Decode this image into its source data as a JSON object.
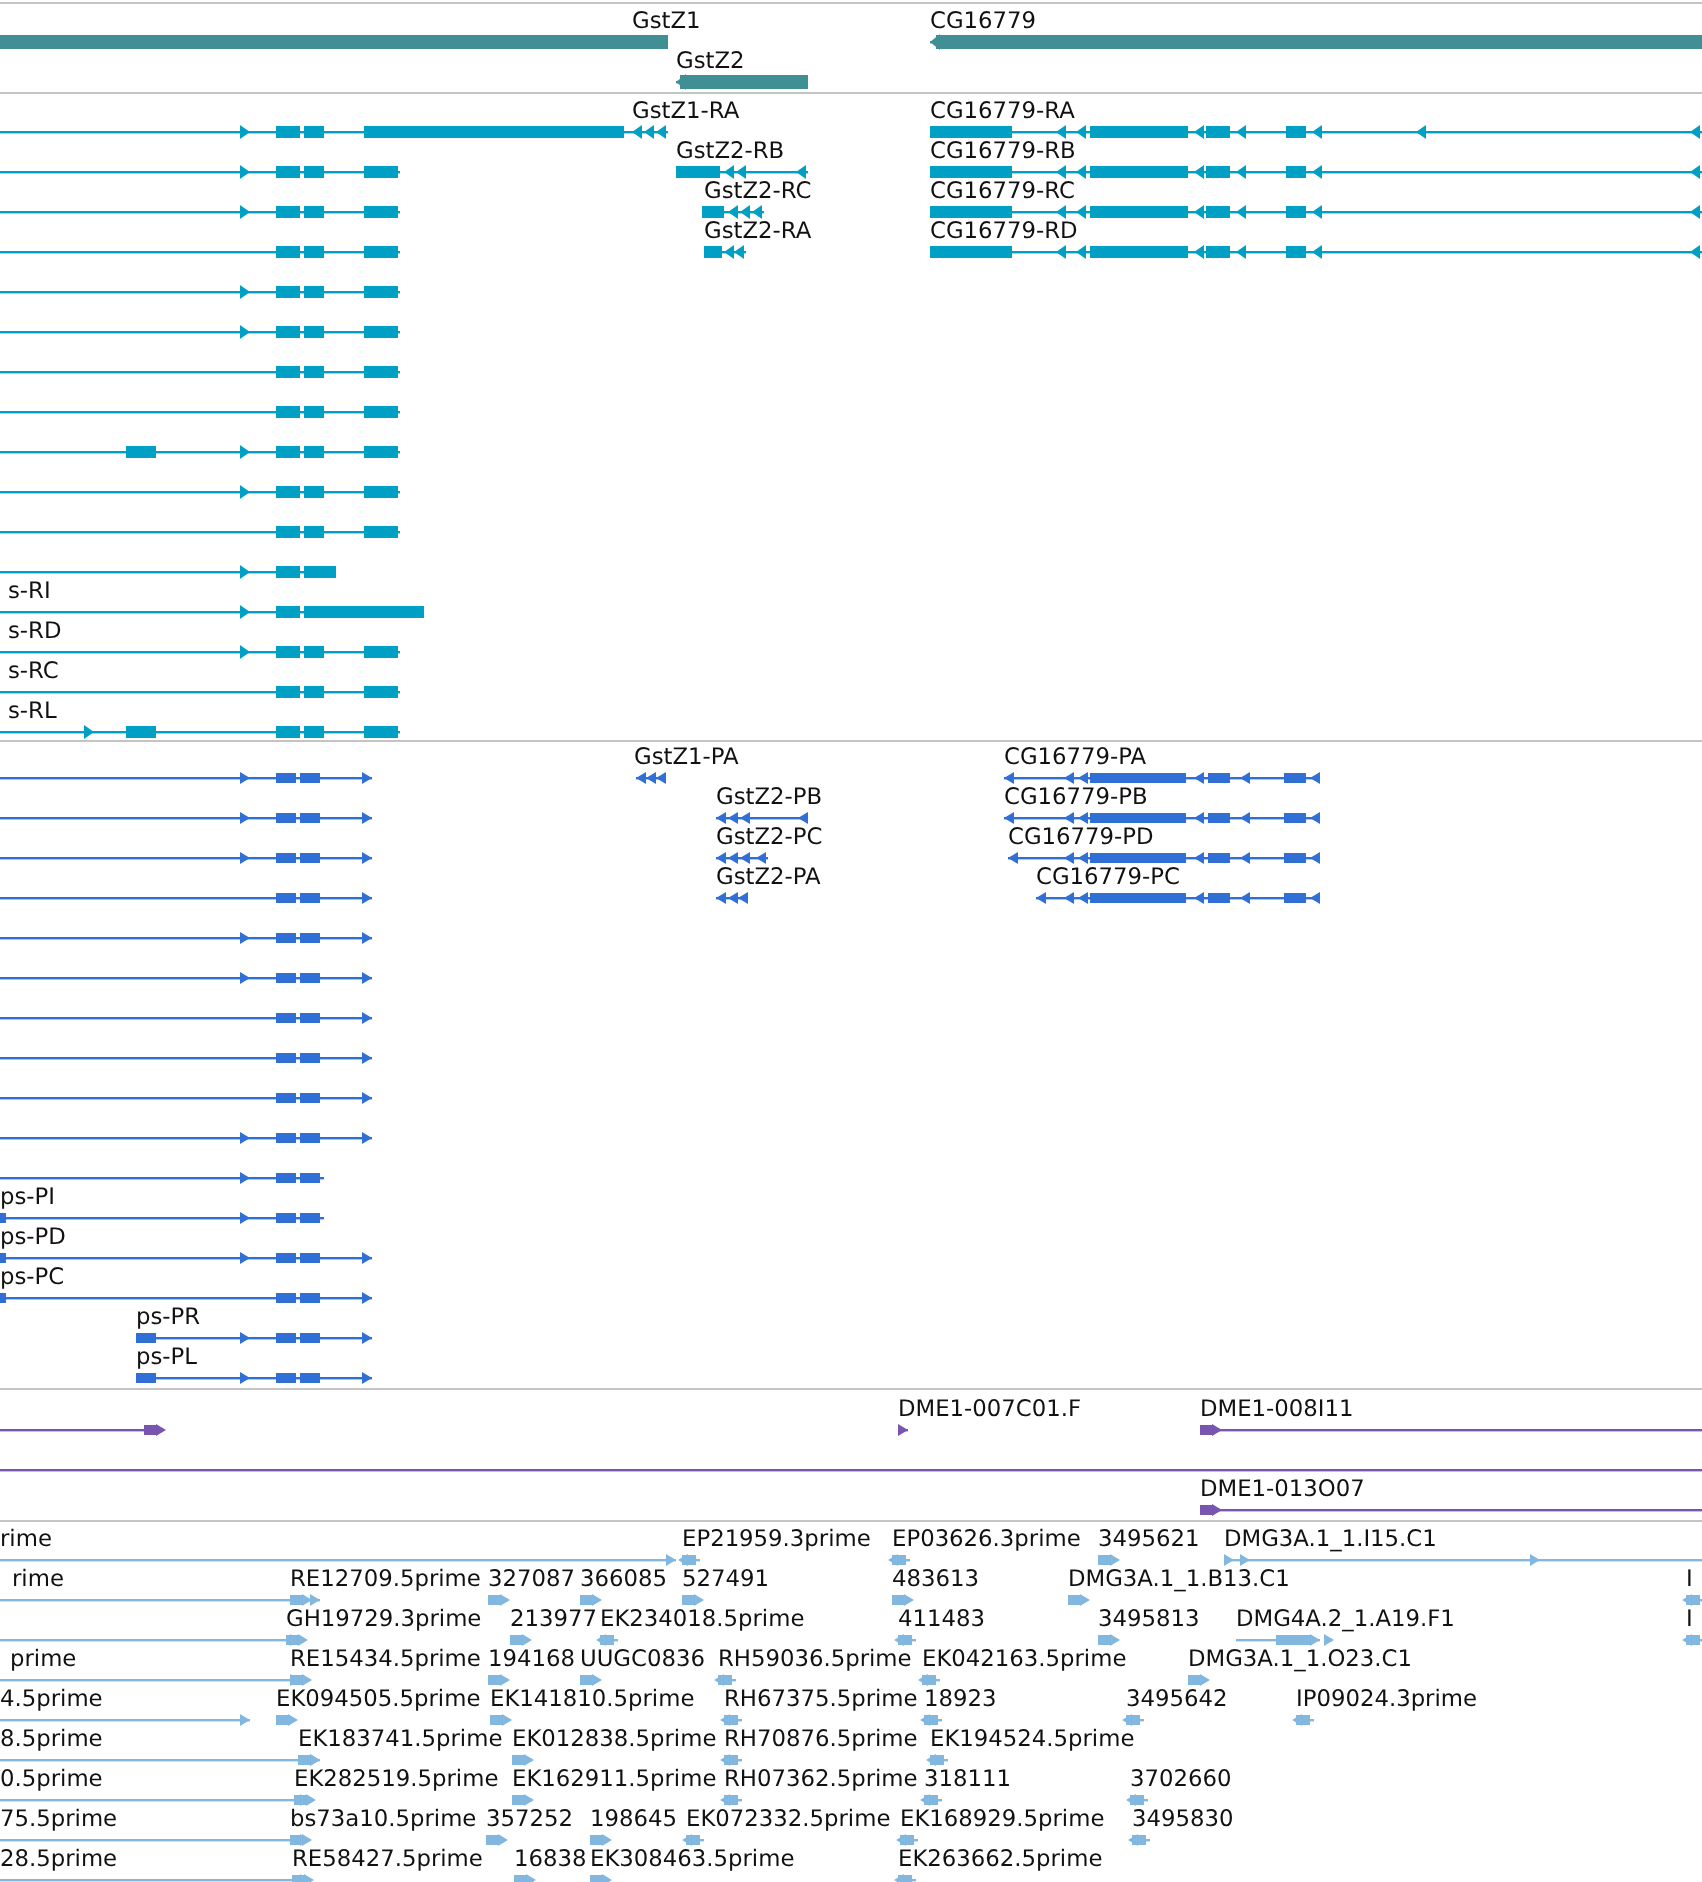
{
  "tracks": [
    {
      "kind": "gene",
      "labels": [
        "GstZ1",
        "GstZ2",
        "CG16779"
      ]
    },
    {
      "kind": "transcript",
      "labels": [
        "GstZ1-RA",
        "CG16779-RA",
        "GstZ2-RB",
        "CG16779-RB",
        "GstZ2-RC",
        "CG16779-RC",
        "GstZ2-RA",
        "CG16779-RD",
        "s-RI",
        "s-RD",
        "s-RC",
        "s-RL"
      ]
    },
    {
      "kind": "protein",
      "labels": [
        "GstZ1-PA",
        "CG16779-PA",
        "GstZ2-PB",
        "CG16779-PB",
        "GstZ2-PC",
        "CG16779-PD",
        "GstZ2-PA",
        "CG16779-PC",
        "ps-PI",
        "ps-PD",
        "ps-PC",
        "ps-PR",
        "ps-PL"
      ]
    },
    {
      "kind": "clone",
      "labels": [
        "DME1-007C01.F",
        "DME1-008I11",
        "DME1-013O07"
      ]
    },
    {
      "kind": "est",
      "labels": [
        "rime",
        "EP21959.3prime",
        "EP03626.3prime",
        "3495621",
        "DMG3A.1_1.I15.C1",
        "rime",
        "RE12709.5prime",
        "327087",
        "366085",
        "527491",
        "483613",
        "DMG3A.1_1.B13.C1",
        "I",
        "GH19729.3prime",
        "213977",
        "EK234018.5prime",
        "411483",
        "3495813",
        "DMG4A.2_1.A19.F1",
        "I",
        "prime",
        "RE15434.5prime",
        "194168",
        "UUGC0836",
        "RH59036.5prime",
        "EK042163.5prime",
        "DMG3A.1_1.O23.C1",
        "4.5prime",
        "EK094505.5prime",
        "EK141810.5prime",
        "RH67375.5prime",
        "18923",
        "3495642",
        "IP09024.3prime",
        "8.5prime",
        "EK183741.5prime",
        "EK012838.5prime",
        "RH70876.5prime",
        "EK194524.5prime",
        "0.5prime",
        "EK282519.5prime",
        "EK162911.5prime",
        "RH07362.5prime",
        "318111",
        "3702660",
        "75.5prime",
        "bs73a10.5prime",
        "357252",
        "198645",
        "EK072332.5prime",
        "EK168929.5prime",
        "3495830",
        "28.5prime",
        "RE58427.5prime",
        "16838",
        "EK308463.5prime",
        "EK263662.5prime"
      ]
    }
  ]
}
